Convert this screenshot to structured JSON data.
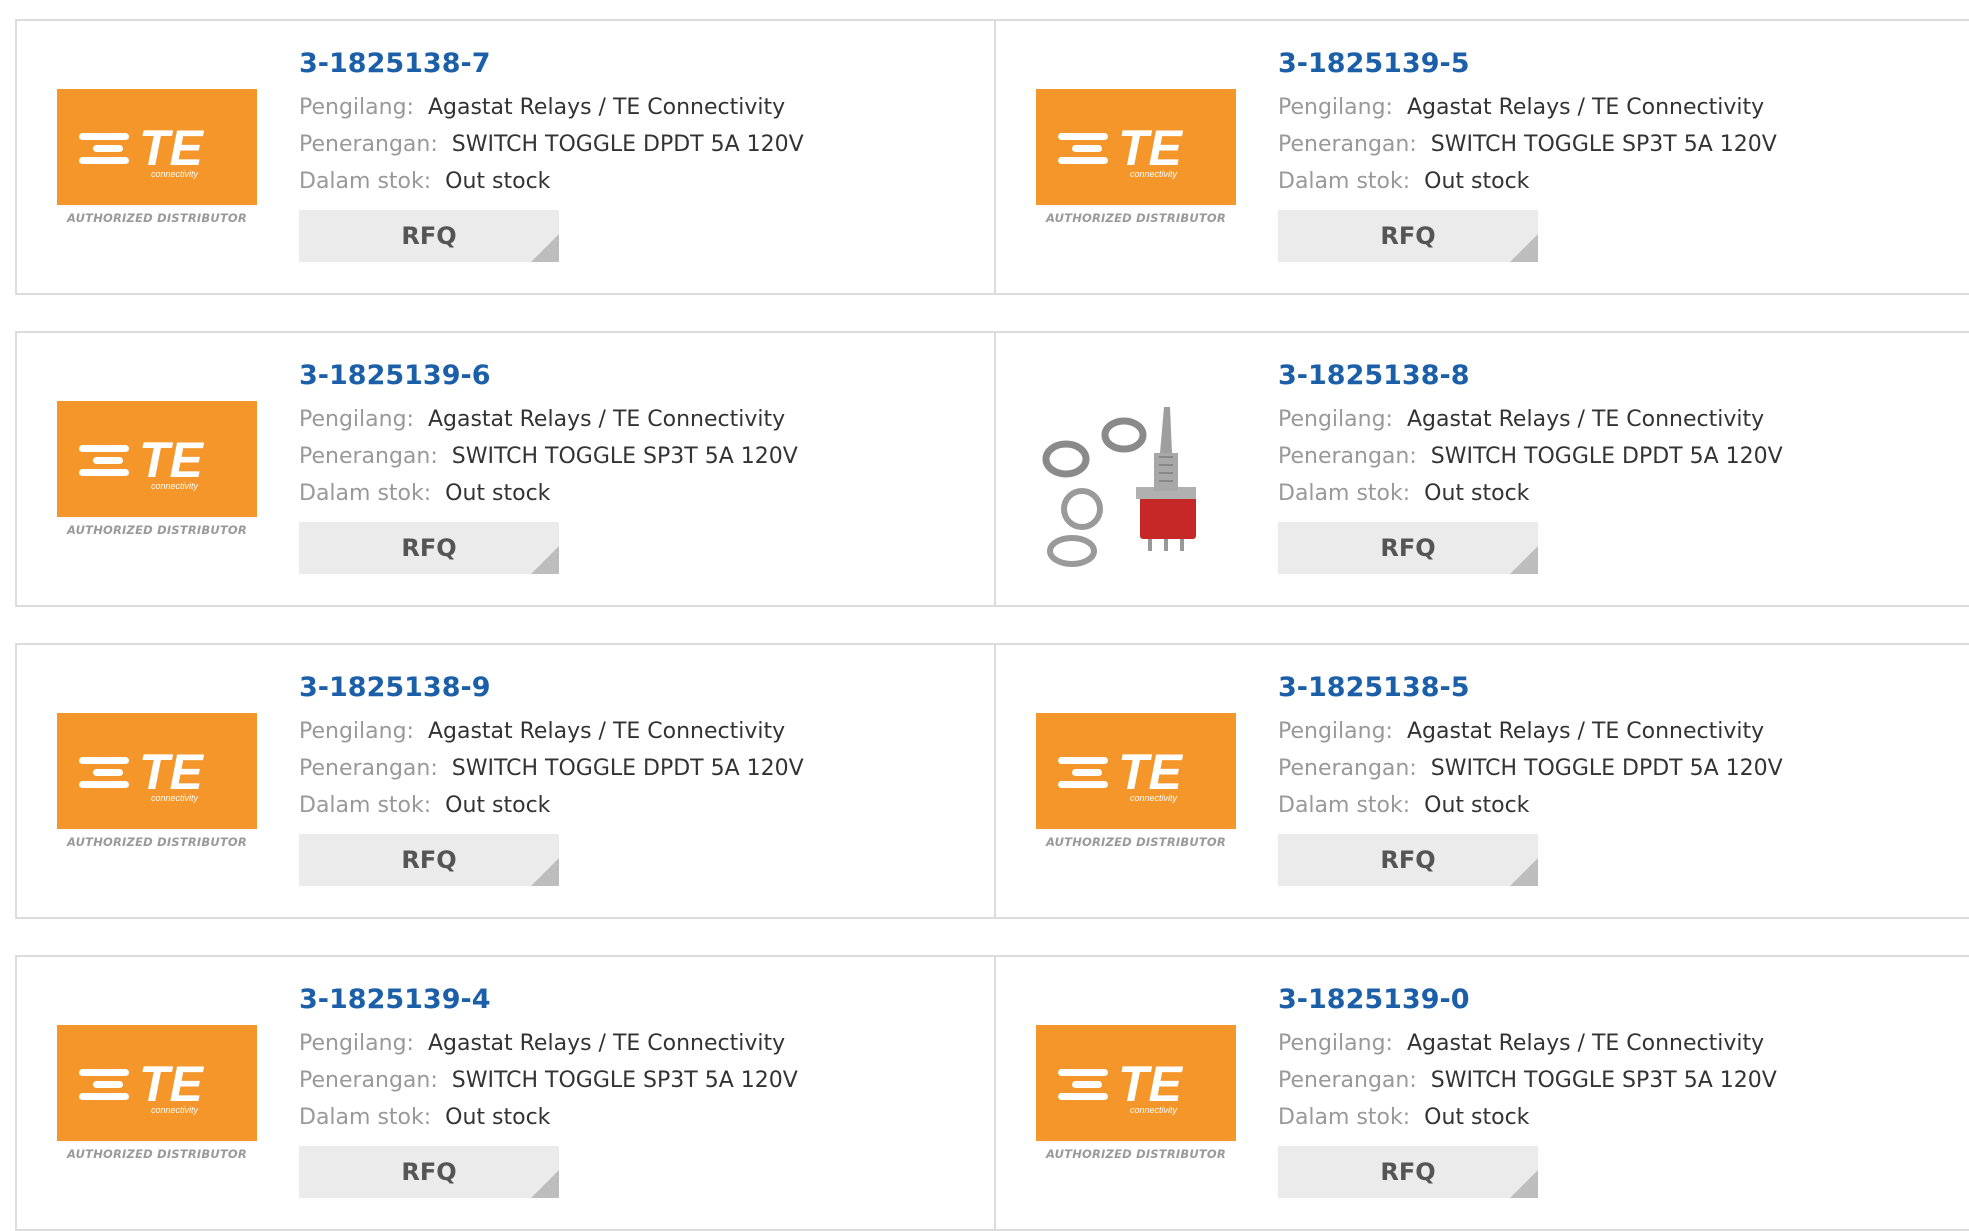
{
  "labels": {
    "manufacturer": "Pengilang:",
    "description": "Penerangan:",
    "stock": "Dalam stok:"
  },
  "logo": {
    "brand": "TE",
    "tagline": "connectivity",
    "caption": "AUTHORIZED DISTRIBUTOR",
    "color": "#f5962a"
  },
  "colors": {
    "link": "#1a5fa8",
    "button_bg": "#ebebeb"
  },
  "products": [
    {
      "part": "3-1825138-7",
      "manufacturer": "Agastat Relays / TE Connectivity",
      "description": "SWITCH TOGGLE DPDT 5A 120V",
      "stock": "Out stock",
      "button": "RFQ",
      "image": "te-logo"
    },
    {
      "part": "3-1825139-5",
      "manufacturer": "Agastat Relays / TE Connectivity",
      "description": "SWITCH TOGGLE SP3T 5A 120V",
      "stock": "Out stock",
      "button": "RFQ",
      "image": "te-logo"
    },
    {
      "part": "3-1825139-6",
      "manufacturer": "Agastat Relays / TE Connectivity",
      "description": "SWITCH TOGGLE SP3T 5A 120V",
      "stock": "Out stock",
      "button": "RFQ",
      "image": "te-logo"
    },
    {
      "part": "3-1825138-8",
      "manufacturer": "Agastat Relays / TE Connectivity",
      "description": "SWITCH TOGGLE DPDT 5A 120V",
      "stock": "Out stock",
      "button": "RFQ",
      "image": "toggle-switch-photo"
    },
    {
      "part": "3-1825138-9",
      "manufacturer": "Agastat Relays / TE Connectivity",
      "description": "SWITCH TOGGLE DPDT 5A 120V",
      "stock": "Out stock",
      "button": "RFQ",
      "image": "te-logo"
    },
    {
      "part": "3-1825138-5",
      "manufacturer": "Agastat Relays / TE Connectivity",
      "description": "SWITCH TOGGLE DPDT 5A 120V",
      "stock": "Out stock",
      "button": "RFQ",
      "image": "te-logo"
    },
    {
      "part": "3-1825139-4",
      "manufacturer": "Agastat Relays / TE Connectivity",
      "description": "SWITCH TOGGLE SP3T 5A 120V",
      "stock": "Out stock",
      "button": "RFQ",
      "image": "te-logo"
    },
    {
      "part": "3-1825139-0",
      "manufacturer": "Agastat Relays / TE Connectivity",
      "description": "SWITCH TOGGLE SP3T 5A 120V",
      "stock": "Out stock",
      "button": "RFQ",
      "image": "te-logo"
    }
  ]
}
